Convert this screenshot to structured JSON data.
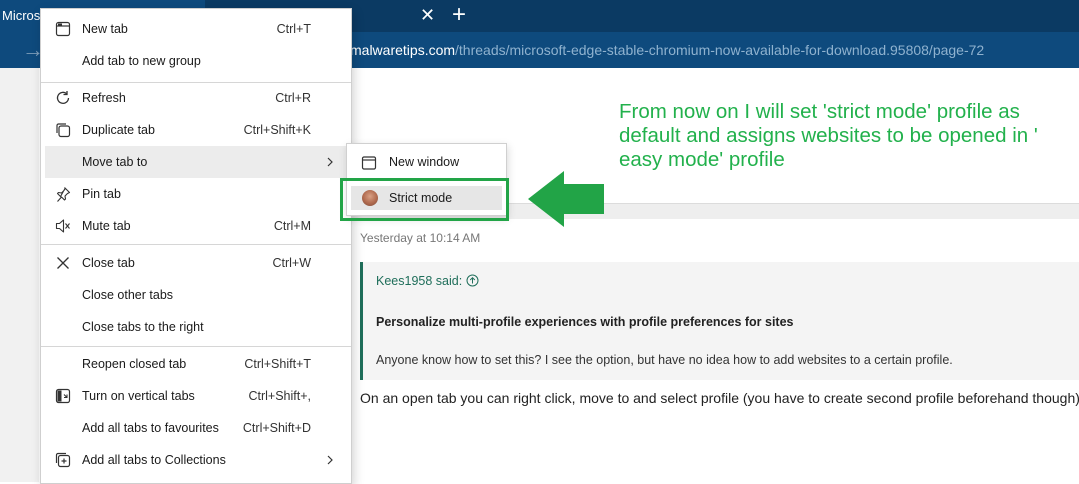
{
  "browser": {
    "tab_title": "Microso",
    "close_glyph": "✕",
    "new_tab_glyph": "+",
    "address_domain": "malwaretips.com",
    "address_path": "/threads/microsoft-edge-stable-chromium-now-available-for-download.95808/page-72",
    "colors": {
      "tabstrip": "#0b3a63",
      "toolbar": "#0e4a7d"
    }
  },
  "context_menu": {
    "items": [
      {
        "label": "New tab",
        "shortcut": "Ctrl+T",
        "icon": "new-tab-icon"
      },
      {
        "label": "Add tab to new group",
        "shortcut": "",
        "icon": ""
      },
      {
        "label": "Refresh",
        "shortcut": "Ctrl+R",
        "icon": "refresh-icon"
      },
      {
        "label": "Duplicate tab",
        "shortcut": "Ctrl+Shift+K",
        "icon": "duplicate-tab-icon"
      },
      {
        "label": "Move tab to",
        "shortcut": "",
        "icon": "",
        "submenu": true
      },
      {
        "label": "Pin tab",
        "shortcut": "",
        "icon": "pin-icon"
      },
      {
        "label": "Mute tab",
        "shortcut": "Ctrl+M",
        "icon": "speaker-mute-icon"
      },
      {
        "label": "Close tab",
        "shortcut": "Ctrl+W",
        "icon": "close-icon"
      },
      {
        "label": "Close other tabs",
        "shortcut": "",
        "icon": ""
      },
      {
        "label": "Close tabs to the right",
        "shortcut": "",
        "icon": ""
      },
      {
        "label": "Reopen closed tab",
        "shortcut": "Ctrl+Shift+T",
        "icon": ""
      },
      {
        "label": "Turn on vertical tabs",
        "shortcut": "Ctrl+Shift+,",
        "icon": "vertical-tabs-icon"
      },
      {
        "label": "Add all tabs to favourites",
        "shortcut": "Ctrl+Shift+D",
        "icon": ""
      },
      {
        "label": "Add all tabs to Collections",
        "shortcut": "",
        "icon": "collections-icon",
        "submenu": true
      }
    ]
  },
  "submenu": {
    "new_window_label": "New window",
    "strict_mode_label": "Strict mode"
  },
  "annotation": {
    "text": "From now on I will set 'strict mode' profile as default and assigns websites to be opened in ' easy mode' profile",
    "color": "#22b14c"
  },
  "post": {
    "date": "Yesterday at 10:14 AM",
    "quote_author": "Kees1958 said:",
    "quote_title": "Personalize multi-profile experiences with profile preferences for sites",
    "quote_body": "Anyone know how to set this? I see the option, but have no idea how to add websites to a certain profile.",
    "reply": "On an open tab you can right click, move to and select profile (you have to create second profile beforehand though)."
  }
}
